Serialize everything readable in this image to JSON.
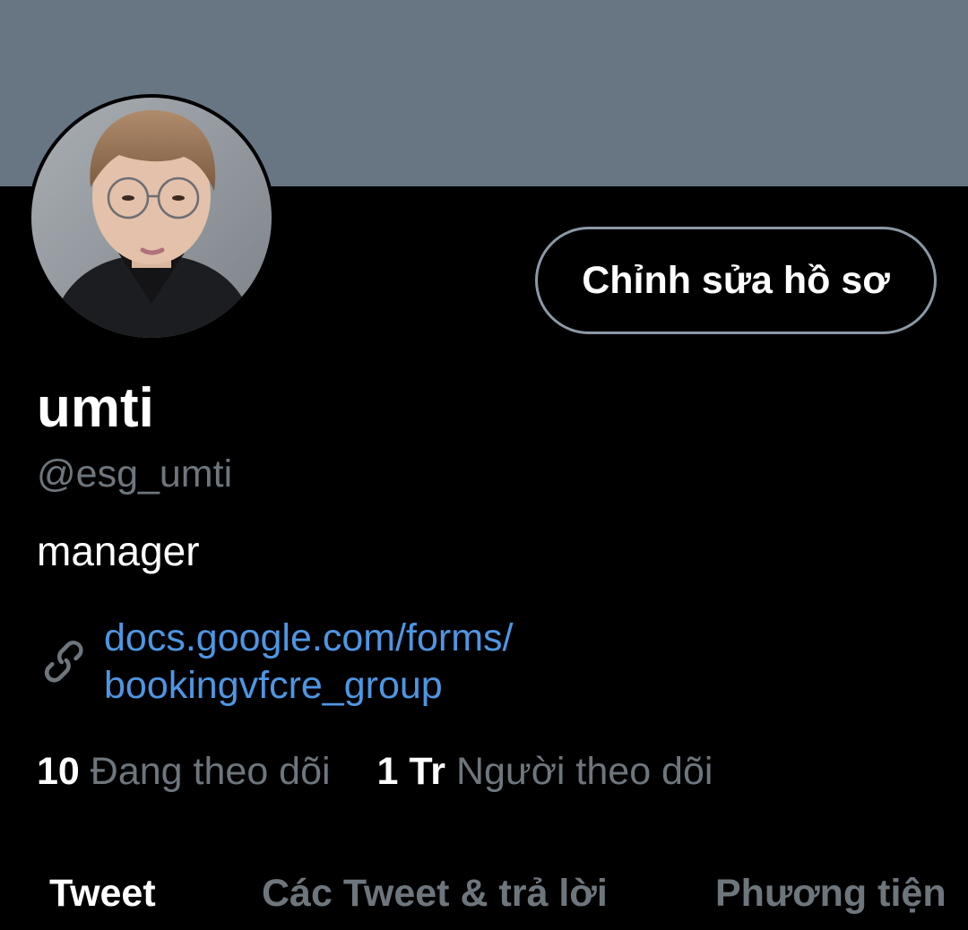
{
  "profile": {
    "display_name": "umti",
    "handle": "@esg_umti",
    "bio": "manager",
    "edit_button_label": "Chỉnh sửa hồ sơ",
    "link_line1": "docs.google.com/forms/",
    "link_line2": "bookingvfcre_group",
    "following_count": "10",
    "following_label": "Đang theo dõi",
    "followers_count": "1 Tr",
    "followers_label": "Người theo dõi"
  },
  "tabs": [
    {
      "label": "Tweet",
      "active": true
    },
    {
      "label": "Các Tweet & trả lời",
      "active": false
    },
    {
      "label": "Phương tiện",
      "active": false
    }
  ],
  "colors": {
    "background": "#000000",
    "banner": "#687684",
    "link": "#4e96e3",
    "muted_text": "#6e767d",
    "button_border": "#8b98a5"
  },
  "icons": {
    "link": "link-icon"
  }
}
